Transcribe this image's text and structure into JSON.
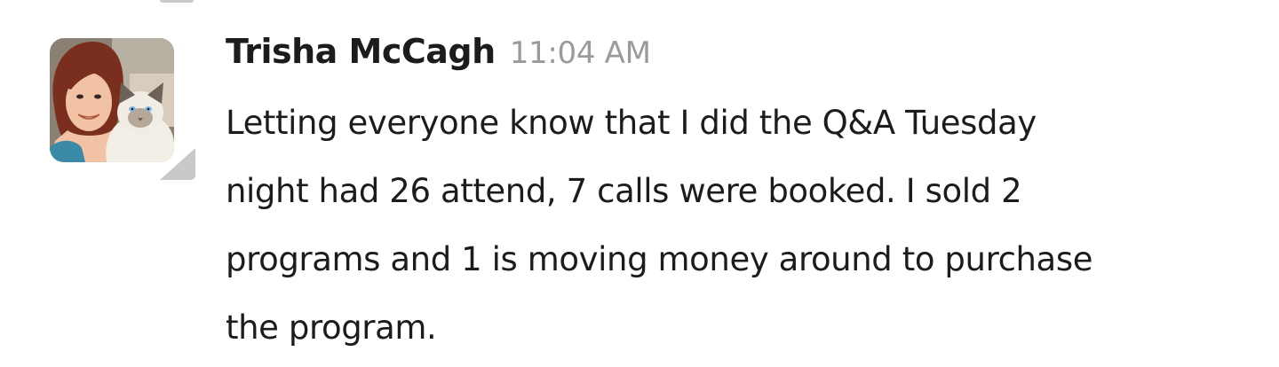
{
  "message": {
    "author": "Trisha McCagh",
    "timestamp": "11:04 AM",
    "lines": [
      "Letting everyone know that I did the Q&A Tuesday",
      "night had 26 attend, 7 calls were booked. I sold 2",
      "programs and 1 is moving money around to purchase",
      "the program."
    ]
  },
  "colors": {
    "text": "#1d1c1d",
    "timestamp": "#9a9a9a",
    "thread_corner": "#c9c9c9"
  },
  "icons": {
    "avatar": "avatar-photo-woman-with-cat",
    "thread_indicator": "thread-corner-icon"
  }
}
